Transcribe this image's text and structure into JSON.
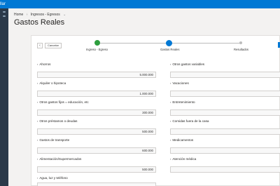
{
  "app": {
    "title": "llar"
  },
  "breadcrumb": {
    "home": "Home",
    "section": "Ingresos - Egresos"
  },
  "page": {
    "title": "Gastos Reales"
  },
  "wizard": {
    "back": "‹",
    "cancel": "Cancelar",
    "steps": [
      {
        "label": "Ingreso - Egreso",
        "state": "done"
      },
      {
        "label": "Gastos Reales",
        "state": "current"
      },
      {
        "label": "Resultados",
        "state": "pending"
      }
    ]
  },
  "fields_left": [
    {
      "label": "Ahorros",
      "value": "5.000.000"
    },
    {
      "label": "Alquiler o hipoteca",
      "value": "1.000.000"
    },
    {
      "label": "Otros gastos fijos = educación, etc",
      "value": "300.000"
    },
    {
      "label": "Otros préstamos o deudas",
      "value": "500.000"
    },
    {
      "label": "Gastos de transporte",
      "value": "600.000"
    },
    {
      "label": "Alimentación/Supermercados",
      "value": "500.000"
    },
    {
      "label": "Agua, luz y teléfono",
      "value": ""
    }
  ],
  "fields_right": [
    {
      "label": "Otros gastos variables",
      "value": ""
    },
    {
      "label": "Vacaciones",
      "value": ""
    },
    {
      "label": "Entretenimiento",
      "value": ""
    },
    {
      "label": "Comidas fuera de la casa",
      "value": ""
    },
    {
      "label": "Medicamentos",
      "value": ""
    },
    {
      "label": "Atención médica",
      "value": ""
    }
  ],
  "colors": {
    "accent": "#0078d4",
    "done": "#2e9e3e"
  }
}
